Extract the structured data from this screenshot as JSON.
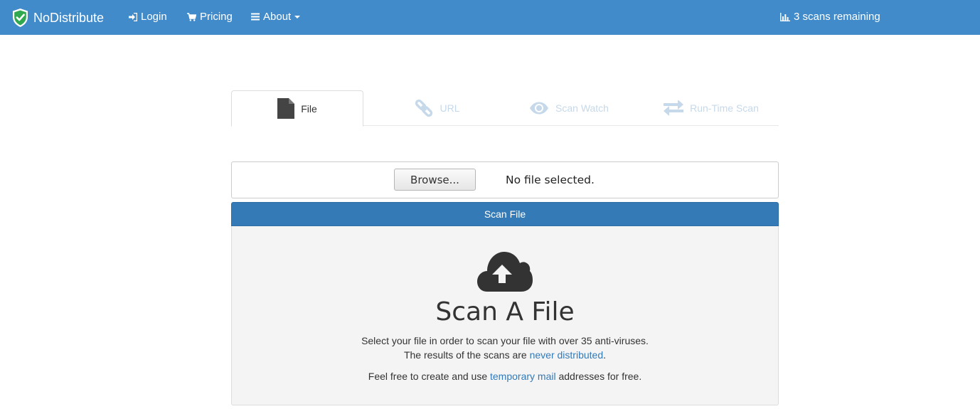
{
  "nav": {
    "brand": "NoDistribute",
    "login": "Login",
    "pricing": "Pricing",
    "about": "About",
    "scans_remaining": "3 scans remaining",
    "colors": {
      "bar": "#428bca",
      "shield": "#2fa84f"
    }
  },
  "tabs": [
    {
      "label": "File",
      "icon": "file-icon",
      "active": true
    },
    {
      "label": "URL",
      "icon": "link-icon",
      "active": false
    },
    {
      "label": "Scan Watch",
      "icon": "eye-icon",
      "active": false
    },
    {
      "label": "Run-Time Scan",
      "icon": "exchange-icon",
      "active": false
    }
  ],
  "upload": {
    "browse_label": "Browse...",
    "file_status": "No file selected.",
    "scan_button": "Scan File"
  },
  "panel": {
    "icon": "cloud-upload-icon",
    "title": "Scan A File",
    "line1": "Select your file in order to scan your file with over 35 anti-viruses.",
    "line2_prefix": "The results of the scans are ",
    "line2_link": "never distributed",
    "line2_suffix": ".",
    "line3_prefix": "Feel free to create and use ",
    "line3_link": "temporary mail",
    "line3_suffix": " addresses for free."
  }
}
